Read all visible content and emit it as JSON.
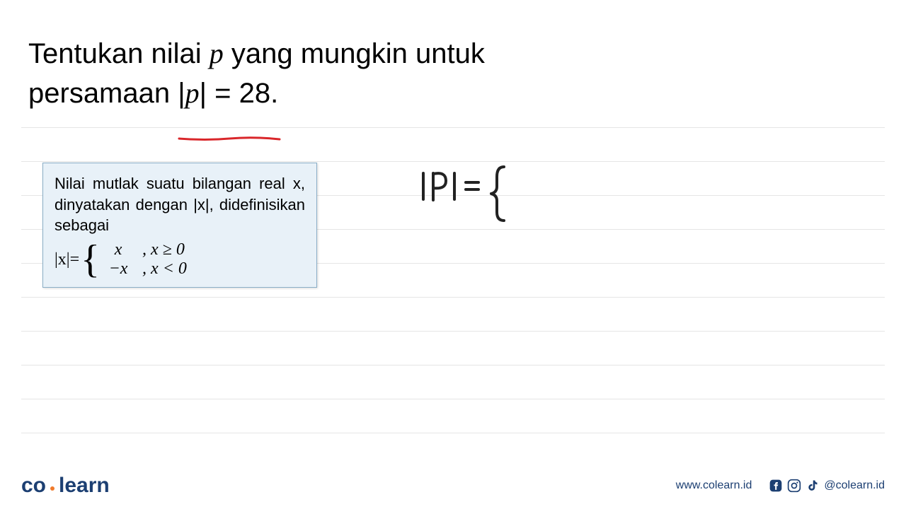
{
  "question": {
    "line1_prefix": "Tentukan nilai ",
    "line1_var": "p",
    "line1_suffix": " yang mungkin untuk",
    "line2_prefix": "persamaan ",
    "equation": "|p| = 28."
  },
  "info_box": {
    "definition": "Nilai mutlak suatu bilangan real x, dinyatakan dengan |x|, didefinisikan sebagai",
    "lhs": "|x|=",
    "case1_val": "x",
    "case1_cond": ", x ≥ 0",
    "case2_val": "−x",
    "case2_cond": ", x < 0"
  },
  "handwriting": {
    "text": "|P| ="
  },
  "footer": {
    "logo_part1": "co",
    "logo_part2": "learn",
    "url": "www.colearn.id",
    "handle": "@colearn.id"
  }
}
